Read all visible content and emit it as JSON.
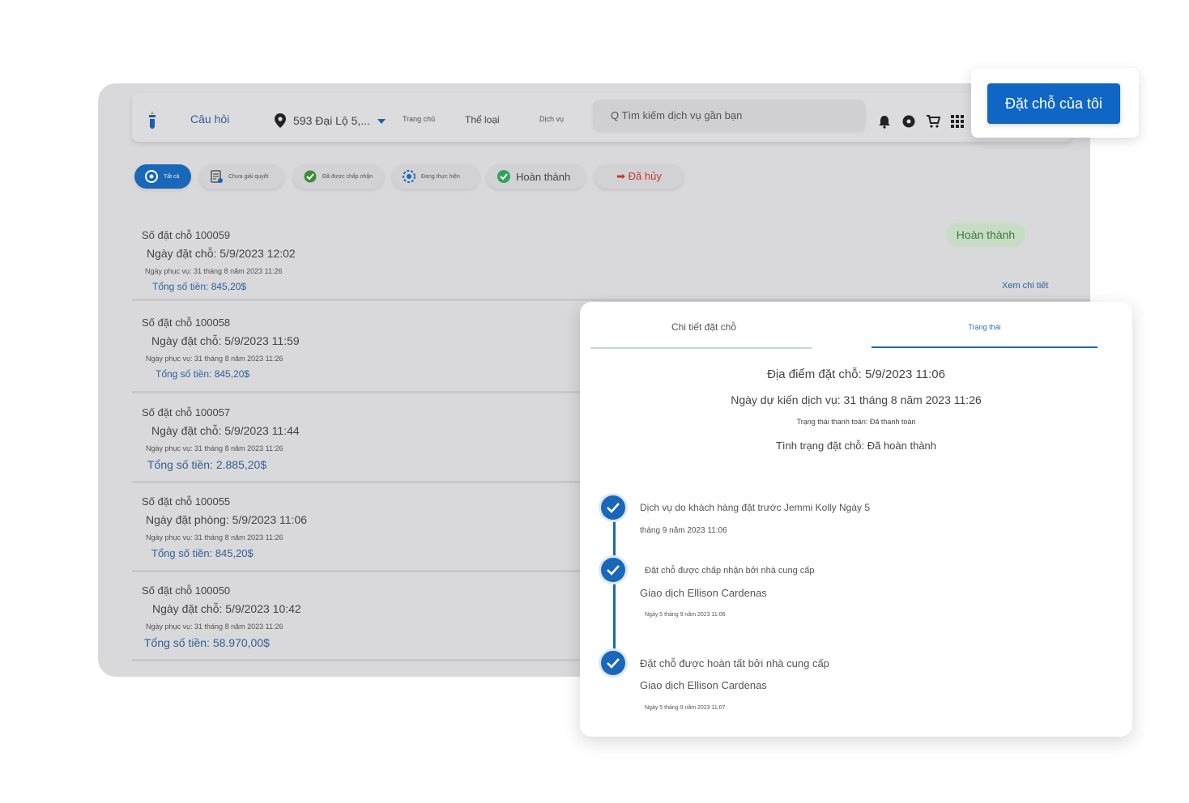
{
  "header": {
    "faq": "Câu hỏi",
    "location": "593 Đại Lộ 5,...",
    "home": "Trang chủ",
    "category": "Thể loại",
    "services": "Dịch vụ",
    "search_placeholder": "Q Tìm kiếm dịch vụ gần bạn",
    "icons": [
      "bell-icon",
      "settings-icon",
      "cart-icon",
      "grid-icon"
    ]
  },
  "cta": {
    "label": "Đặt chỗ của tôi"
  },
  "filters": [
    {
      "label": "Tất cả",
      "icon": "all-icon",
      "active": true
    },
    {
      "label": "Chưa giải quyết",
      "icon": "clipboard-icon"
    },
    {
      "label": "Đã được chấp nhận",
      "icon": "accepted-icon"
    },
    {
      "label": "Đang thực hiện",
      "icon": "in-progress-icon"
    },
    {
      "label": "Hoàn thành",
      "icon": "check-circle-icon"
    },
    {
      "label": "➡ Đã hủy",
      "icon": "cancel-icon"
    }
  ],
  "bookings": [
    {
      "number": "Số đặt chỗ 100059",
      "date": "Ngày đặt chỗ: 5/9/2023 12:02",
      "service": "Ngày phục vụ: 31 tháng 8 năm 2023 11:26",
      "total": "Tổng số tiền: 845,20$",
      "status": "Hoàn thành",
      "link": "Xem chi tiết"
    },
    {
      "number": "Số đặt chỗ 100058",
      "date": "Ngày đặt chỗ: 5/9/2023 11:59",
      "service": "Ngày phục vụ: 31 tháng 8 năm 2023 11:26",
      "total": "Tổng số tiền: 845,20$"
    },
    {
      "number": "Số đặt chỗ 100057",
      "date": "Ngày đặt chỗ: 5/9/2023 11:44",
      "service": "Ngày phục vụ: 31 tháng 8 năm 2023 11:26",
      "total": "Tổng số tiền: 2.885,20$"
    },
    {
      "number": "Số đặt chỗ 100055",
      "date": "Ngày đặt phòng: 5/9/2023 11:06",
      "service": "Ngày phục vụ: 31 tháng 8 năm 2023 11:26",
      "total": "Tổng số tiền: 845,20$"
    },
    {
      "number": "Số đặt chỗ 100050",
      "date": "Ngày đặt chỗ: 5/9/2023 10:42",
      "service": "Ngày phục vụ: 31 tháng 8 năm 2023 11:26",
      "total": "Tổng số tiền: 58.970,00$"
    }
  ],
  "panel": {
    "tabs": {
      "detail": "Chi tiết đặt chỗ",
      "status": "Trạng thái"
    },
    "location_date": "Địa điểm đặt chỗ: 5/9/2023 11:06",
    "expected_date": "Ngày dự kiến dịch vụ: 31 tháng 8 năm 2023 11:26",
    "payment_status": "Trạng thái thanh toán: Đã thanh toán",
    "booking_status": "Tình trạng đặt chỗ: Đã hoàn thành",
    "timeline": [
      {
        "title": "Dịch vụ do khách hàng đặt trước Jemmi Kolly Ngày 5",
        "sub": "",
        "time": "tháng 9 năm 2023 11:06"
      },
      {
        "title": "Đặt chỗ được chấp nhận bởi nhà cung cấp",
        "sub": "Giao dịch Ellison Cardenas",
        "time": "Ngày 5 tháng 9 năm 2023 11:06"
      },
      {
        "title": "Đặt chỗ được hoàn tất bởi nhà cung cấp",
        "sub": "Giao dịch Ellison Cardenas",
        "time": "Ngày 5 tháng 9 năm 2023 11:07"
      }
    ]
  },
  "colors": {
    "primary": "#0f66c4",
    "success_bg": "#c7dcc5",
    "success_text": "#3b7a3a",
    "cancel": "#c0392b"
  }
}
